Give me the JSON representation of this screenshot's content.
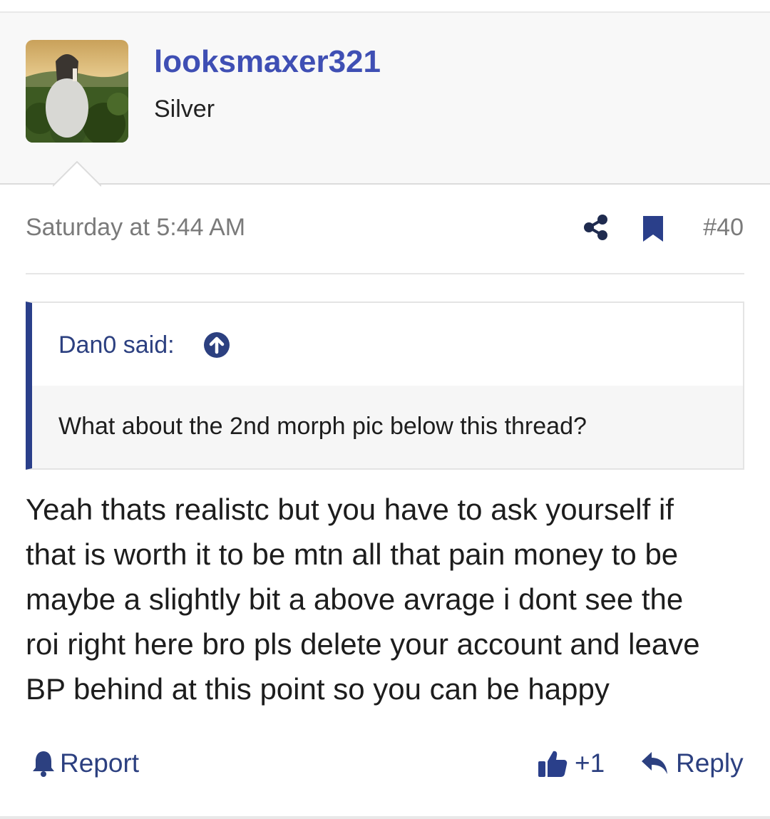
{
  "post": {
    "author": {
      "username": "looksmaxer321",
      "user_title": "Silver",
      "avatar_icon": "avatar-photo"
    },
    "meta": {
      "date": "Saturday at 5:44 AM",
      "post_number": "#40",
      "share_icon": "share-icon",
      "bookmark_icon": "bookmark-icon"
    },
    "quote": {
      "author_label": "Dan0 said:",
      "text": "What about the 2nd morph pic below this thread?",
      "jump_icon": "arrow-up-circle-icon"
    },
    "message": {
      "lines": [
        "Yeah thats realistc but you have to ask yourself if",
        "that is worth it to be mtn all that pain money to be",
        "maybe a slightly bit a above avrage i dont see the",
        "roi right here bro pls delete your account and leave",
        "BP behind at this point so you can be happy"
      ]
    },
    "actions": {
      "report_label": "Report",
      "like_count": "+1",
      "reply_label": "Reply"
    }
  },
  "colors": {
    "accent": "#3f4fb4",
    "link": "#2c4080",
    "quote_bar": "#2a3f8a",
    "meta_text": "#7a7a7a",
    "body_text": "#1d1d1d"
  }
}
